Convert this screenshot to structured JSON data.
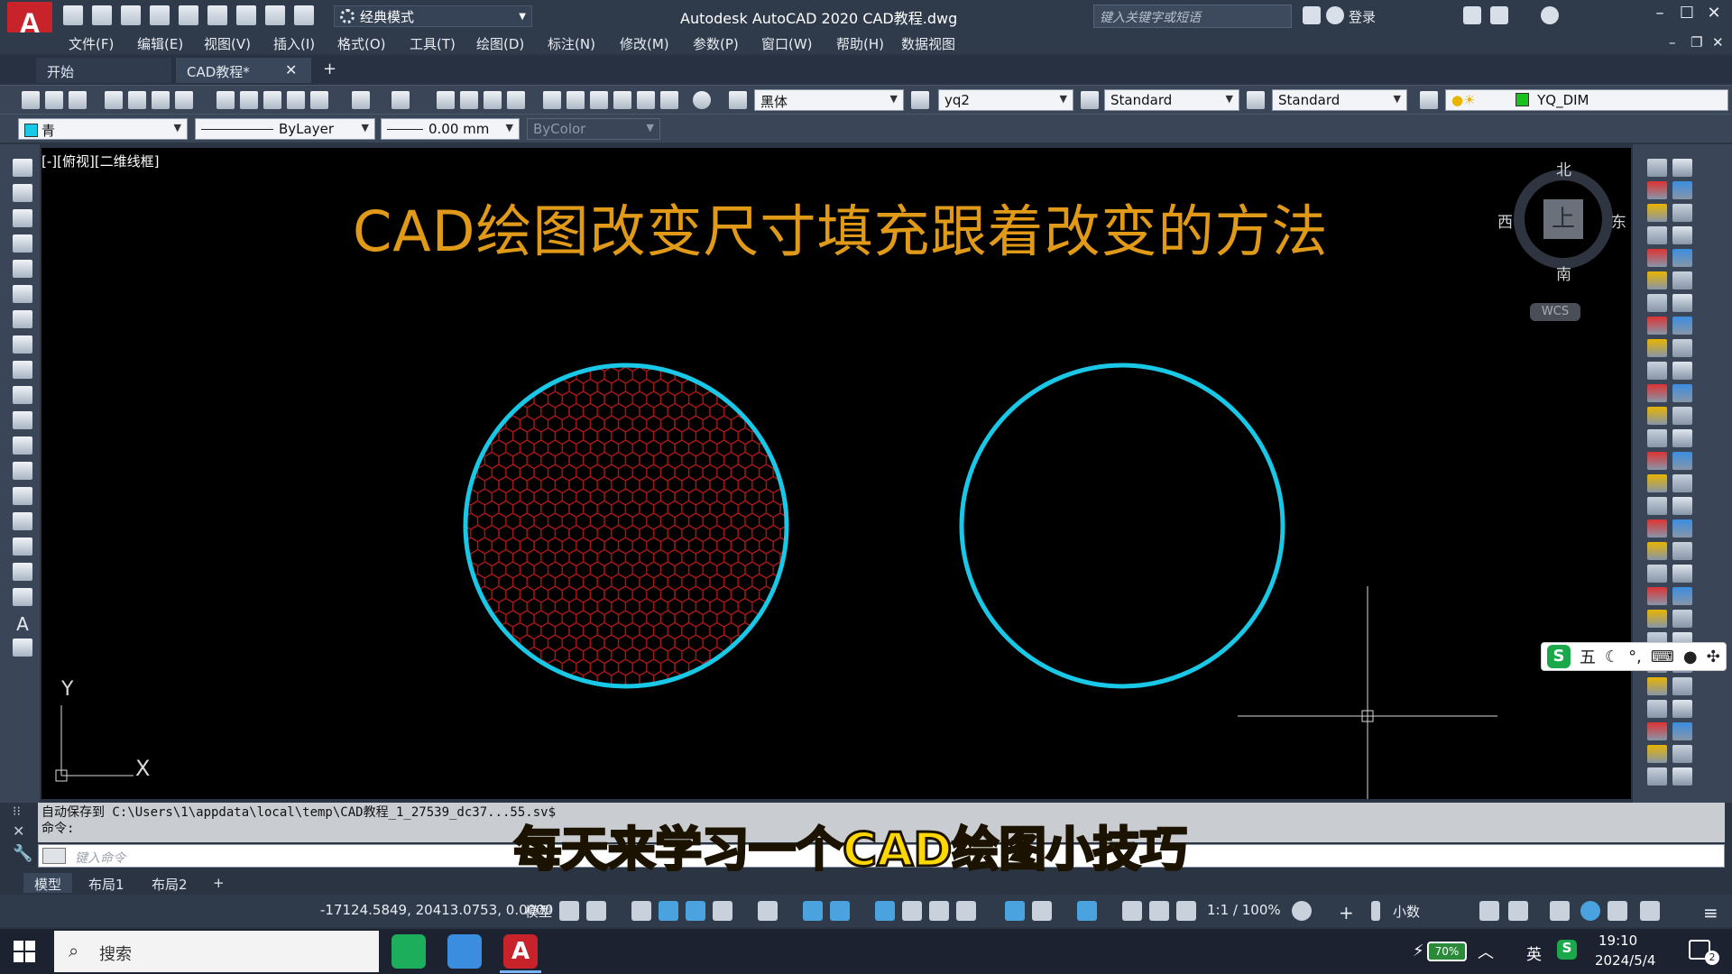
{
  "titlebar": {
    "app_logo": "A",
    "workspace": "经典模式",
    "window_title": "Autodesk AutoCAD 2020    CAD教程.dwg",
    "search_placeholder": "键入关键字或短语",
    "login": "登录"
  },
  "menu": [
    "文件(F)",
    "编辑(E)",
    "视图(V)",
    "插入(I)",
    "格式(O)",
    "工具(T)",
    "绘图(D)",
    "标注(N)",
    "修改(M)",
    "参数(P)",
    "窗口(W)",
    "帮助(H)",
    "数据视图"
  ],
  "tabs": {
    "start": "开始",
    "drawing": "CAD教程*",
    "close": "✕",
    "add": "+"
  },
  "toolbar1": {
    "text_style_font": "黑体",
    "dim_style": "yq2",
    "table_style": "Standard",
    "multileader_style": "Standard",
    "layer": "YQ_DIM"
  },
  "toolbar2": {
    "color": "青",
    "linetype": "ByLayer",
    "lineweight": "0.00 mm",
    "plot_style": "ByColor"
  },
  "canvas": {
    "viewport_label": "[-][俯视][二维线框]",
    "title": "CAD绘图改变尺寸填充跟着改变的方法",
    "compass": {
      "north": "北",
      "south": "南",
      "east": "东",
      "west": "西",
      "top": "上"
    },
    "wcs": "WCS",
    "ucs_x": "X",
    "ucs_y": "Y",
    "colors": {
      "circle": "#19c8e6",
      "hatch": "#b01818",
      "title": "#e09a18"
    }
  },
  "command": {
    "history_line1": "自动保存到 C:\\Users\\1\\appdata\\local\\temp\\CAD教程_1_27539_dc37...55.sv$",
    "history_line2": "命令:",
    "input_placeholder": "键入命令"
  },
  "subtitle": "每天来学习一个CAD绘图小技巧",
  "layout_tabs": [
    "模型",
    "布局1",
    "布局2",
    "+"
  ],
  "statusbar": {
    "coords": "-17124.5849, 20413.0753, 0.0000",
    "model": "模型",
    "scale": "1:1 / 100%",
    "units": "小数"
  },
  "ime": {
    "logo": "S",
    "mode": "五"
  },
  "taskbar": {
    "search": "搜索",
    "battery": "70%",
    "ime_lang": "英",
    "time": "19:10",
    "date": "2024/5/4",
    "notifications": "2"
  }
}
